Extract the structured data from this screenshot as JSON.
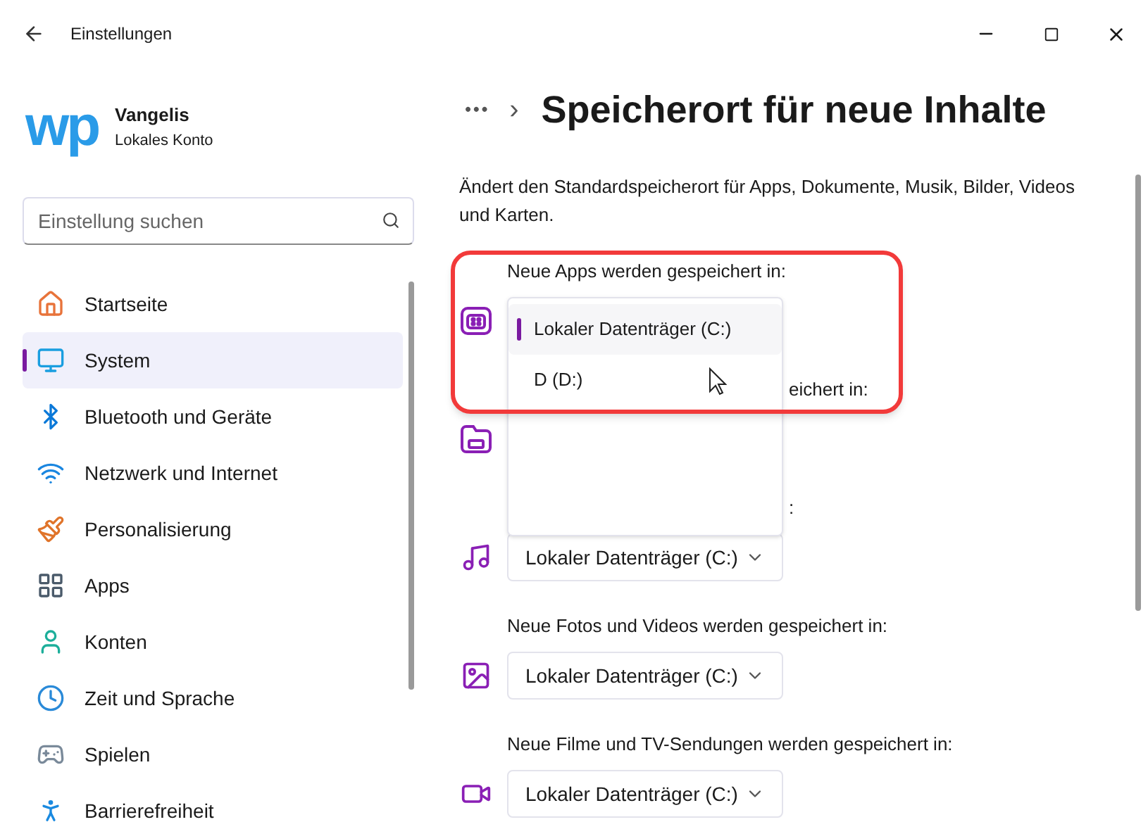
{
  "window": {
    "title": "Einstellungen"
  },
  "profile": {
    "avatar_text": "wp",
    "name": "Vangelis",
    "account": "Lokales Konto"
  },
  "search": {
    "placeholder": "Einstellung suchen"
  },
  "sidebar": {
    "items": [
      {
        "label": "Startseite",
        "selected": false
      },
      {
        "label": "System",
        "selected": true
      },
      {
        "label": "Bluetooth und Geräte",
        "selected": false
      },
      {
        "label": "Netzwerk und Internet",
        "selected": false
      },
      {
        "label": "Personalisierung",
        "selected": false
      },
      {
        "label": "Apps",
        "selected": false
      },
      {
        "label": "Konten",
        "selected": false
      },
      {
        "label": "Zeit und Sprache",
        "selected": false
      },
      {
        "label": "Spielen",
        "selected": false
      },
      {
        "label": "Barrierefreiheit",
        "selected": false
      }
    ]
  },
  "breadcrumb": {
    "overflow": "•••",
    "separator": "›",
    "title": "Speicherort für neue Inhalte"
  },
  "description": "Ändert den Standardspeicherort für Apps, Dokumente, Musik, Bilder, Videos und Karten.",
  "settings": [
    {
      "label": "Neue Apps werden gespeichert in:",
      "expanded": true,
      "options": [
        {
          "label": "Lokaler Datenträger (C:)",
          "selected": true
        },
        {
          "label": "D (D:)",
          "selected": false
        }
      ]
    },
    {
      "label": "eichert in:",
      "expanded": false
    },
    {
      "label": ":",
      "expanded": false,
      "value": "Lokaler Datenträger (C:)"
    },
    {
      "label": "Neue Fotos und Videos werden gespeichert in:",
      "expanded": false,
      "value": "Lokaler Datenträger (C:)"
    },
    {
      "label": "Neue Filme und TV-Sendungen werden gespeichert in:",
      "expanded": false,
      "value": "Lokaler Datenträger (C:)"
    }
  ]
}
